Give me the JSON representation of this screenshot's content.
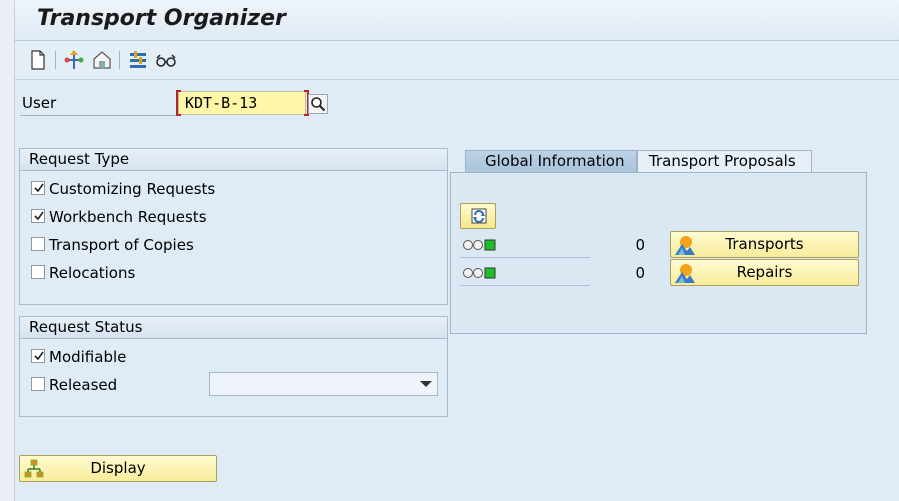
{
  "window": {
    "title": "Transport Organizer"
  },
  "toolbar": {
    "icons": [
      "new-document-icon",
      "hierarchy-icon",
      "transport-icon",
      "settings-icon",
      "glasses-icon"
    ]
  },
  "user": {
    "label": "User",
    "value": "KDT-B-13"
  },
  "request_type": {
    "title": "Request Type",
    "items": [
      {
        "label": "Customizing Requests",
        "checked": true
      },
      {
        "label": "Workbench Requests",
        "checked": true
      },
      {
        "label": "Transport of Copies",
        "checked": false
      },
      {
        "label": "Relocations",
        "checked": false
      }
    ]
  },
  "request_status": {
    "title": "Request Status",
    "items": [
      {
        "label": "Modifiable",
        "checked": true
      },
      {
        "label": "Released",
        "checked": false
      }
    ],
    "released_dropdown_value": ""
  },
  "display_button": {
    "label": "Display"
  },
  "tabs": [
    {
      "label": "Global Information",
      "active": true
    },
    {
      "label": "Transport Proposals",
      "active": false
    }
  ],
  "global_info": {
    "rows": [
      {
        "count": "0",
        "button_label": "Transports",
        "status_color": "#1fbf2a"
      },
      {
        "count": "0",
        "button_label": "Repairs",
        "status_color": "#1fbf2a"
      }
    ]
  }
}
